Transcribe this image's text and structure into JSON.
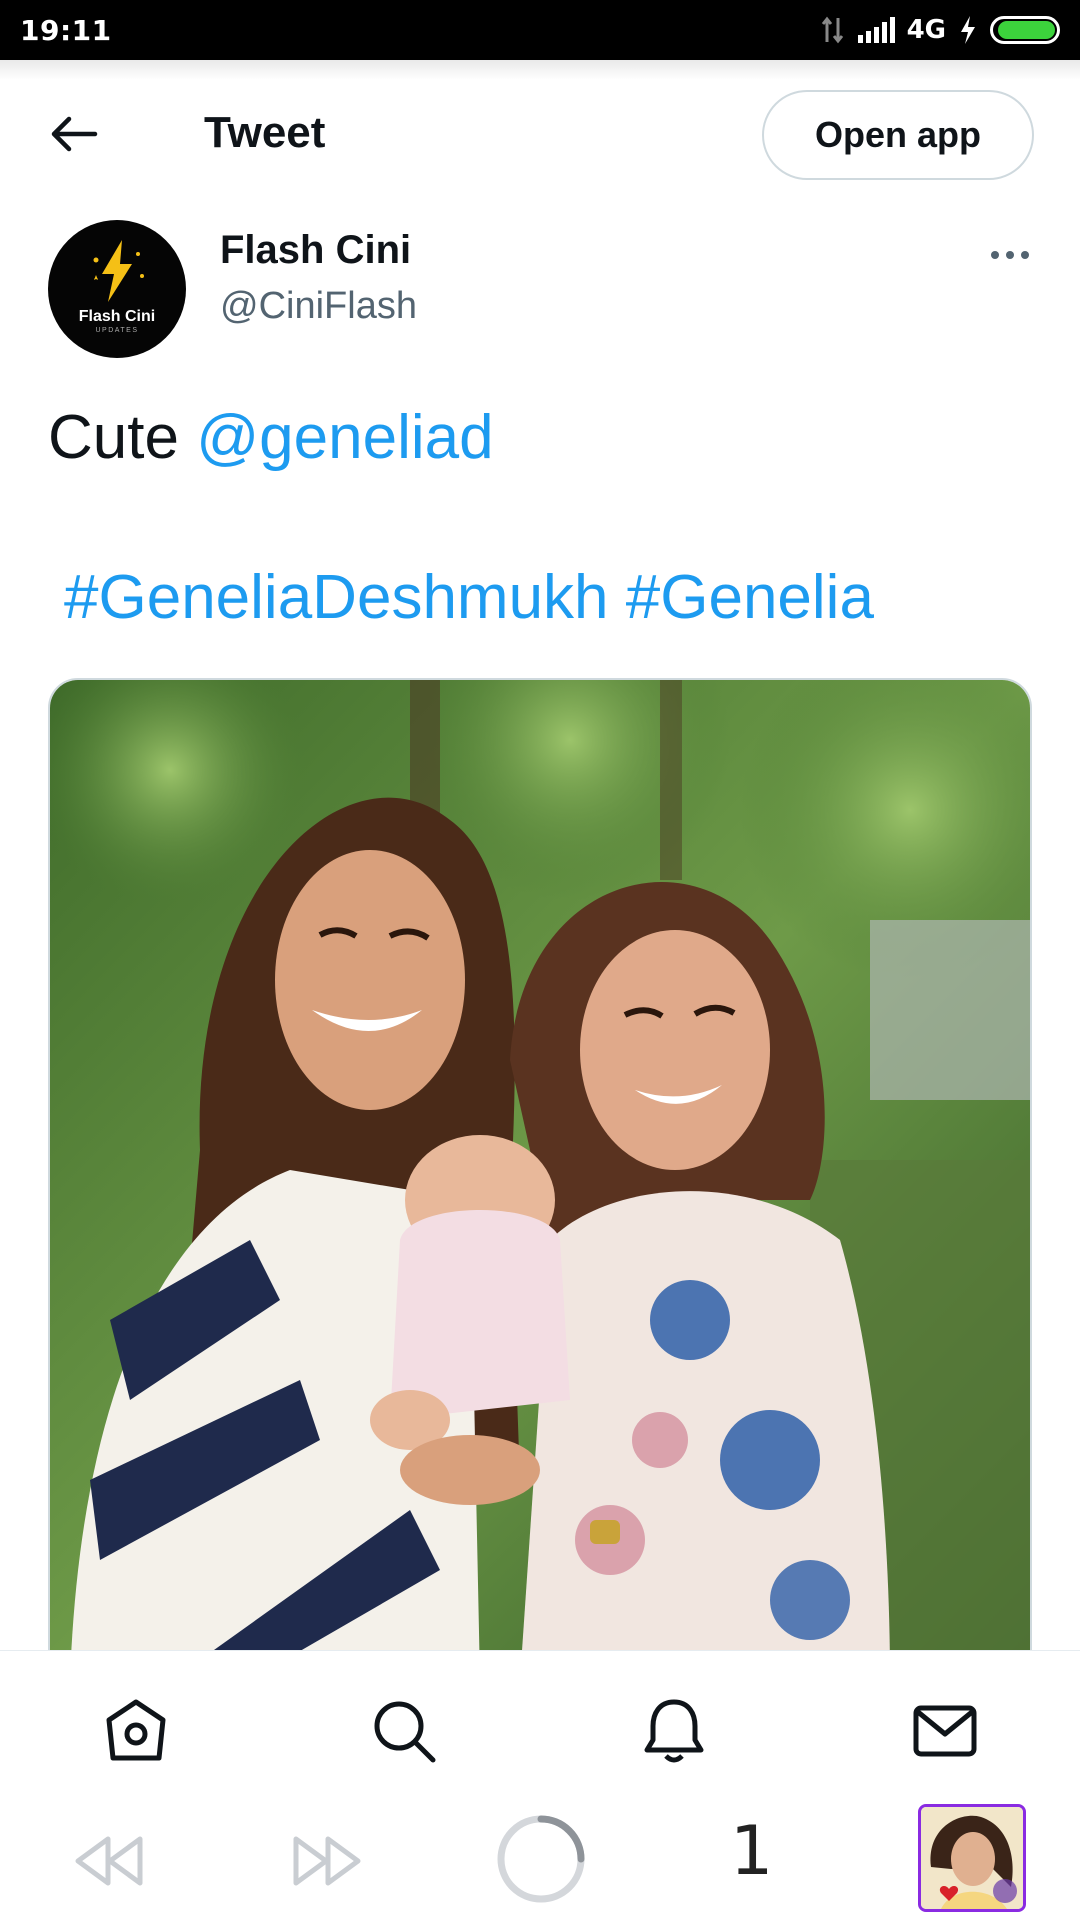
{
  "status_bar": {
    "time": "19:11",
    "network": "4G",
    "battery_level": 0.95
  },
  "header": {
    "title": "Tweet",
    "open_app_label": "Open app"
  },
  "tweet": {
    "author_name": "Flash Cini",
    "author_handle": "@CiniFlash",
    "avatar_text": "Flash Cini",
    "avatar_subtext": "UPDATES",
    "text_prefix": "Cute ",
    "mention": "@geneliad",
    "hashtags": "#GeneliaDeshmukh #Genelia"
  },
  "bottom_nav": {
    "items": [
      "home",
      "search",
      "notifications",
      "messages"
    ]
  },
  "browser": {
    "tab_count": "1"
  },
  "colors": {
    "accent": "#1d9bf0",
    "text": "#0f1419",
    "secondary": "#536471",
    "border": "#cfd9de"
  }
}
